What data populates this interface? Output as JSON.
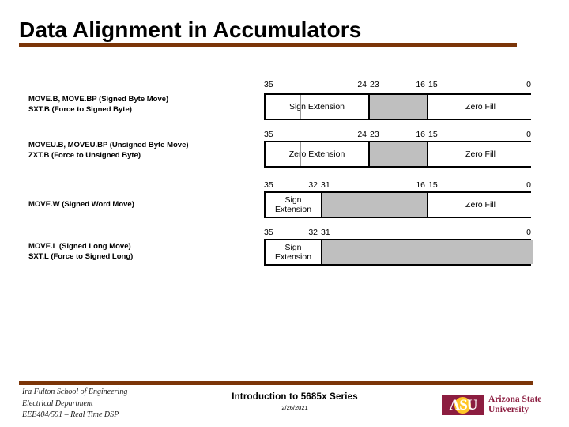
{
  "slide": {
    "title": "Data Alignment in Accumulators",
    "accent_color": "#7B3508",
    "gray_fill": "#BFBFBF"
  },
  "rows": [
    {
      "labels": [
        "MOVE.B, MOVE.BP (Signed Byte Move)",
        "SXT.B (Force to Signed Byte)"
      ],
      "bits": [
        {
          "value": "35",
          "align": "left",
          "pos": 0
        },
        {
          "value": "24",
          "align": "right",
          "pos": 130
        },
        {
          "value": "23",
          "align": "left",
          "pos": 134
        },
        {
          "value": "16",
          "align": "right",
          "pos": 204
        },
        {
          "value": "15",
          "align": "left",
          "pos": 208
        },
        {
          "value": "0",
          "align": "right",
          "pos": 338
        }
      ],
      "segments": [
        {
          "label": "Sign Extension",
          "fill": "white",
          "start": 0,
          "end": 130
        },
        {
          "label": "",
          "fill": "gray",
          "start": 130,
          "end": 206
        },
        {
          "label": "Zero Fill",
          "fill": "white",
          "start": 206,
          "end": 338
        }
      ],
      "faint_divider": 44
    },
    {
      "labels": [
        "MOVEU.B, MOVEU.BP (Unsigned Byte Move)",
        "ZXT.B (Force to Unsigned Byte)"
      ],
      "bits": [
        {
          "value": "35",
          "align": "left",
          "pos": 0
        },
        {
          "value": "24",
          "align": "right",
          "pos": 130
        },
        {
          "value": "23",
          "align": "left",
          "pos": 134
        },
        {
          "value": "16",
          "align": "right",
          "pos": 204
        },
        {
          "value": "15",
          "align": "left",
          "pos": 208
        },
        {
          "value": "0",
          "align": "right",
          "pos": 338
        }
      ],
      "segments": [
        {
          "label": "Zero Extension",
          "fill": "white",
          "start": 0,
          "end": 130
        },
        {
          "label": "",
          "fill": "gray",
          "start": 130,
          "end": 206
        },
        {
          "label": "Zero Fill",
          "fill": "white",
          "start": 206,
          "end": 338
        }
      ],
      "faint_divider": 44
    },
    {
      "labels": [
        "MOVE.W (Signed Word Move)"
      ],
      "bits": [
        {
          "value": "35",
          "align": "left",
          "pos": 0
        },
        {
          "value": "32",
          "align": "right",
          "pos": 68
        },
        {
          "value": "31",
          "align": "left",
          "pos": 72
        },
        {
          "value": "16",
          "align": "right",
          "pos": 204
        },
        {
          "value": "15",
          "align": "left",
          "pos": 208
        },
        {
          "value": "0",
          "align": "right",
          "pos": 338
        }
      ],
      "segments": [
        {
          "label": "Sign Extension",
          "fill": "white",
          "start": 0,
          "end": 70
        },
        {
          "label": "",
          "fill": "gray",
          "start": 70,
          "end": 206
        },
        {
          "label": "Zero Fill",
          "fill": "white",
          "start": 206,
          "end": 338
        }
      ],
      "faint_divider": null
    },
    {
      "labels": [
        "MOVE.L (Signed Long Move)",
        "SXT.L (Force to Signed Long)"
      ],
      "bits": [
        {
          "value": "35",
          "align": "left",
          "pos": 0
        },
        {
          "value": "32",
          "align": "right",
          "pos": 68
        },
        {
          "value": "31",
          "align": "left",
          "pos": 72
        },
        {
          "value": "0",
          "align": "right",
          "pos": 338
        }
      ],
      "segments": [
        {
          "label": "Sign Extension",
          "fill": "white",
          "start": 0,
          "end": 70
        },
        {
          "label": "",
          "fill": "gray",
          "start": 70,
          "end": 338
        }
      ],
      "faint_divider": null
    }
  ],
  "footer": {
    "left_lines": [
      "Ira Fulton School of Engineering",
      "Electrical Department",
      "EEE404/591 – Real Time DSP"
    ],
    "center_title": "Introduction to 5685x Series",
    "center_date": "2/26/2021",
    "logo": {
      "mark_text": "ASU",
      "wordmark_line1": "Arizona State",
      "wordmark_line2": "University",
      "maroon": "#8C1D40",
      "gold": "#FFC627"
    }
  }
}
